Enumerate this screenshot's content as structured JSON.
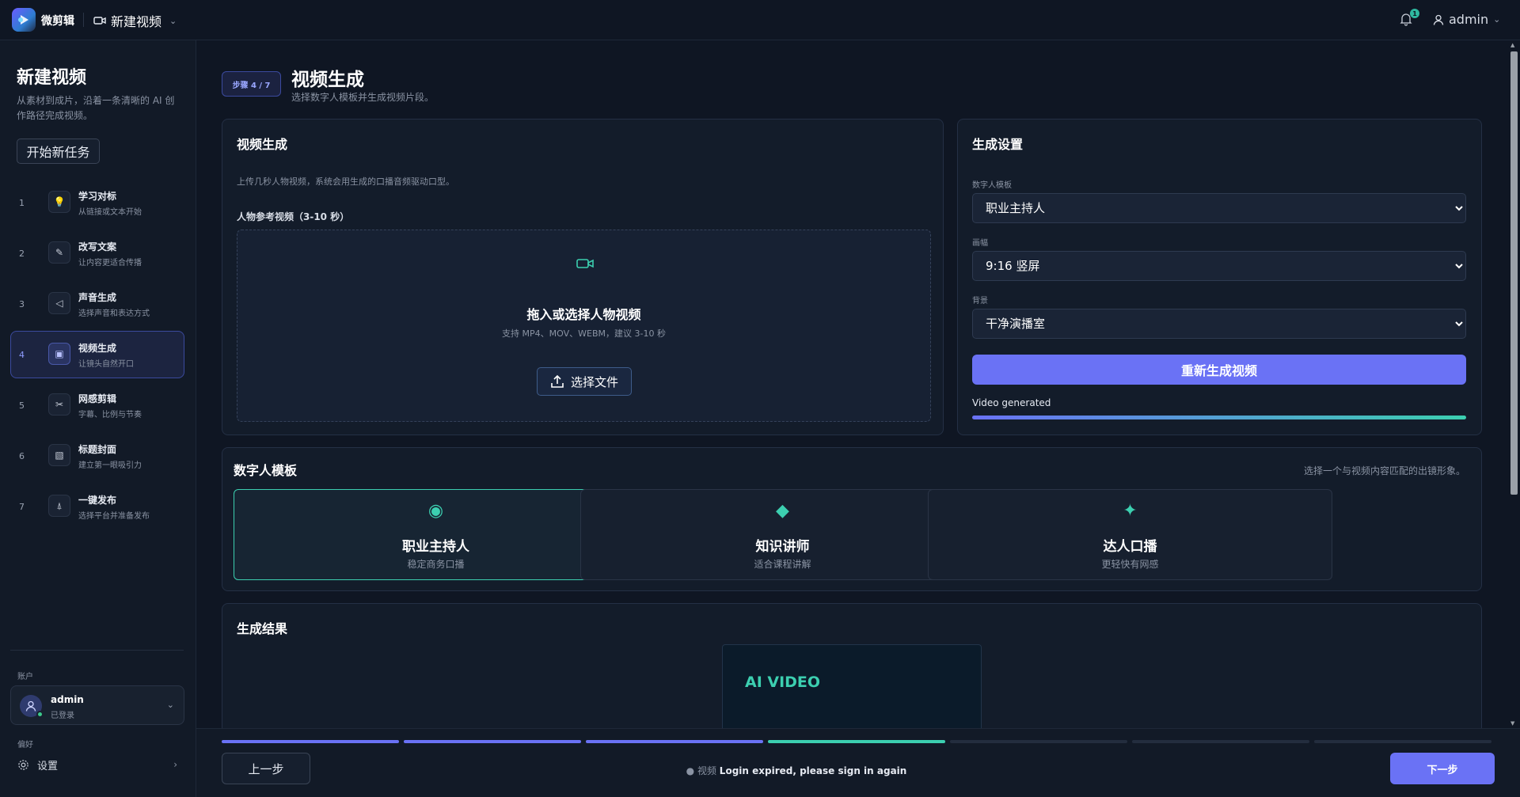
{
  "app": {
    "brand": "微剪辑",
    "page_title": "新建视频"
  },
  "header": {
    "notification_count": "1",
    "user": "admin"
  },
  "sidebar": {
    "title": "新建视频",
    "description": "从素材到成片，沿着一条清晰的 AI 创作路径完成视频。",
    "new_task_label": "开始新任务",
    "steps": [
      {
        "num": "1",
        "title": "学习对标",
        "subtitle": "从链接或文本开始",
        "icon": "lightbulb-icon"
      },
      {
        "num": "2",
        "title": "改写文案",
        "subtitle": "让内容更适合传播",
        "icon": "pencil-icon"
      },
      {
        "num": "3",
        "title": "声音生成",
        "subtitle": "选择声音和表达方式",
        "icon": "play-triangle-icon"
      },
      {
        "num": "4",
        "title": "视频生成",
        "subtitle": "让镜头自然开口",
        "icon": "video-frame-icon"
      },
      {
        "num": "5",
        "title": "网感剪辑",
        "subtitle": "字幕、比例与节奏",
        "icon": "scissors-icon"
      },
      {
        "num": "6",
        "title": "标题封面",
        "subtitle": "建立第一眼吸引力",
        "icon": "cover-image-icon"
      },
      {
        "num": "7",
        "title": "一键发布",
        "subtitle": "选择平台并准备发布",
        "icon": "publish-icon"
      }
    ],
    "account_label": "账户",
    "account_name": "admin",
    "account_status": "已登录",
    "preferences_label": "偏好",
    "settings_label": "设置"
  },
  "main": {
    "step_chip": "步骤 4 / 7",
    "title": "视频生成",
    "subtitle": "选择数字人模板并生成视频片段。",
    "upload_card": {
      "title": "视频生成",
      "hint": "上传几秒人物视频，系统会用生成的口播音频驱动口型。",
      "ref_label": "人物参考视频（3-10 秒）",
      "drop_title": "拖入或选择人物视频",
      "drop_desc": "支持 MP4、MOV、WEBM，建议 3-10 秒",
      "choose_file": "选择文件"
    },
    "settings_card": {
      "title": "生成设置",
      "template_label": "数字人模板",
      "template_value": "职业主持人",
      "ratio_label": "画幅",
      "ratio_value": "9:16 竖屏",
      "bg_label": "背景",
      "bg_value": "干净演播室",
      "regen_label": "重新生成视频",
      "progress_text": "Video generated",
      "progress": 1.0
    },
    "templates_card": {
      "title": "数字人模板",
      "note": "选择一个与视频内容匹配的出镜形象。",
      "items": [
        {
          "title": "职业主持人",
          "desc": "稳定商务口播",
          "glyph": "◉",
          "icon": "target-icon",
          "selected": true
        },
        {
          "title": "知识讲师",
          "desc": "适合课程讲解",
          "glyph": "◆",
          "icon": "diamond-icon",
          "selected": false
        },
        {
          "title": "达人口播",
          "desc": "更轻快有网感",
          "glyph": "✦",
          "icon": "sparkle-icon",
          "selected": false
        }
      ]
    },
    "result_card": {
      "title": "生成结果",
      "preview_text": "AI VIDEO"
    }
  },
  "footer": {
    "progress_segments": [
      "done",
      "done",
      "done",
      "current",
      "todo",
      "todo",
      "todo"
    ],
    "prev_label": "上一步",
    "status_prefix": "● 视频",
    "status_message": "Login expired, please sign in again",
    "next_label": "下一步"
  },
  "colors": {
    "accent": "#6a72f5",
    "teal": "#3ccfb0",
    "bg": "#0f1623"
  }
}
